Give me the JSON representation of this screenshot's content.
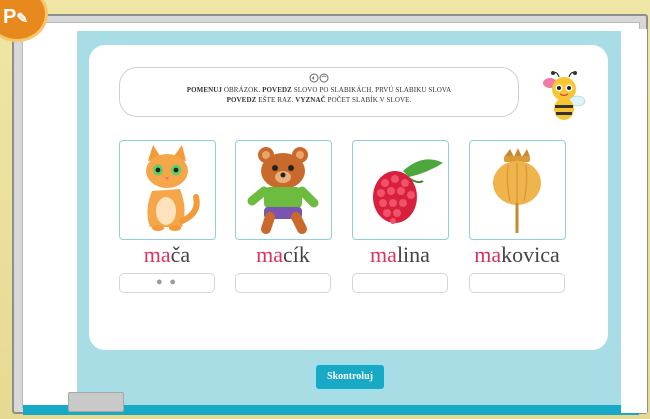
{
  "logo": {
    "text": "P"
  },
  "instruction": {
    "icon": "listen-icon",
    "line1_bold1": "POMENUJ",
    "line1_rest1": " OBRÁZOK. ",
    "line1_bold2": "POVEDZ",
    "line1_rest2": " SLOVO PO SLABIKÁCH. PRVÚ SLABIKU SLOVA",
    "line2_bold1": "POVEDZ",
    "line2_rest1": " EŠTE RAZ. ",
    "line2_bold2": "VYZNAČ",
    "line2_rest2": " POČET SLABÍK V SLOVE."
  },
  "cards": [
    {
      "image": "cat-picture",
      "hl": "ma",
      "rest": "ča",
      "answer": "● ●"
    },
    {
      "image": "teddy-bear-picture",
      "hl": "ma",
      "rest": "cík",
      "answer": ""
    },
    {
      "image": "raspberry-picture",
      "hl": "ma",
      "rest": "lina",
      "answer": ""
    },
    {
      "image": "poppy-head-picture",
      "hl": "ma",
      "rest": "kovica",
      "answer": ""
    }
  ],
  "check_button": {
    "label": "Skontroluj"
  },
  "colors": {
    "accent": "#18a9c7",
    "highlight": "#d8345f",
    "screen_bg": "#a9dde6",
    "frame": "#e8dd9a"
  }
}
